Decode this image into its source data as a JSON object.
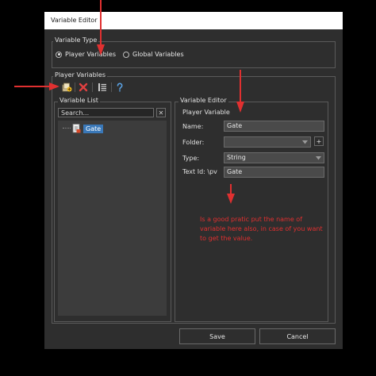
{
  "window": {
    "title": "Variable Editor"
  },
  "variable_type": {
    "group_label": "Variable Type",
    "options": [
      {
        "label": "Player Variables",
        "selected": true
      },
      {
        "label": "Global Variables",
        "selected": false
      }
    ]
  },
  "player_variables": {
    "group_label": "Player Variables",
    "toolbar": [
      {
        "name": "add-variable-button",
        "icon": "add-variable-icon"
      },
      {
        "name": "delete-variable-button",
        "icon": "delete-x-icon"
      },
      {
        "name": "list-view-button",
        "icon": "list-icon"
      },
      {
        "name": "help-button",
        "icon": "help-icon"
      }
    ],
    "variable_list": {
      "group_label": "Variable List",
      "search_placeholder": "Search...",
      "clear_label": "✕",
      "items": [
        {
          "label": "Gate",
          "selected": true
        }
      ]
    },
    "variable_editor": {
      "group_label": "Variable Editor",
      "subheading": "Player Variable",
      "name_label": "Name:",
      "name_value": "Gate",
      "folder_label": "Folder:",
      "folder_value": "",
      "add_folder_label": "+",
      "type_label": "Type:",
      "type_value": "String",
      "text_id_label": "Text Id: \\pv",
      "text_id_value": "Gate"
    }
  },
  "buttons": {
    "save": "Save",
    "cancel": "Cancel"
  },
  "annotation": {
    "note": "Is a good pratic put the name of variable here also, in case of you want to get the value.",
    "color": "#e03030"
  },
  "colors": {
    "selection": "#3a78b8",
    "window_bg": "#2e2e2e"
  }
}
